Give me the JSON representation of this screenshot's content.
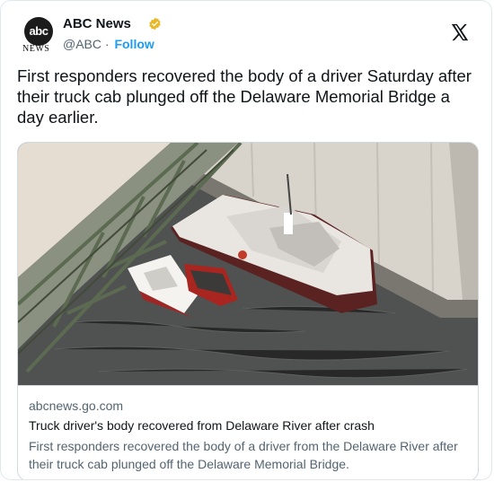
{
  "tweet": {
    "author_name": "ABC News",
    "avatar_text": "abc",
    "avatar_sub": "NEWS",
    "handle": "@ABC",
    "separator": "·",
    "follow_label": "Follow",
    "text": "First responders recovered the body of a driver Saturday after their truck cab plunged off the Delaware Memorial Bridge a day earlier."
  },
  "link_card": {
    "domain": "abcnews.go.com",
    "title": "Truck driver's body recovered from Delaware River after crash",
    "description": "First responders recovered the body of a driver from the Delaware River after their truck cab plunged off the Delaware Memorial Bridge."
  },
  "icons": {
    "verified": "verified-badge-icon",
    "platform": "x-logo-icon"
  },
  "colors": {
    "verified_gold": "#e8b829",
    "follow_blue": "#1d9bf0",
    "text_primary": "#0f1419",
    "text_secondary": "#536471"
  }
}
